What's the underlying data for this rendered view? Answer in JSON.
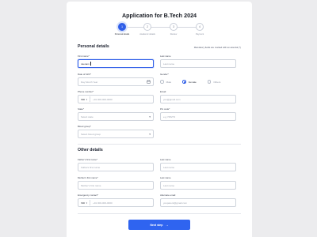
{
  "title": "Application for B.Tech 2024",
  "stepper": [
    {
      "num": "1",
      "label": "Personal details",
      "active": true
    },
    {
      "num": "2",
      "label": "Academic details",
      "active": false
    },
    {
      "num": "3",
      "label": "Review",
      "active": false
    },
    {
      "num": "4",
      "label": "Payment",
      "active": false
    }
  ],
  "personal": {
    "heading": "Personal details",
    "note": "Mandatory fields are marked with an asterisk (*)",
    "first_name": {
      "label": "First name*",
      "value": "Jeenam"
    },
    "last_name": {
      "label": "Last name",
      "placeholder": "Last name"
    },
    "dob": {
      "label": "Date of birth*",
      "placeholder": "Day Month Year",
      "icon": "calendar-icon"
    },
    "gender": {
      "label": "Gender*",
      "options": [
        "Male",
        "Female",
        "Others"
      ],
      "selected": "Female"
    },
    "phone": {
      "label": "Phone number*",
      "prefix": "IND",
      "placeholder": "+91 000-000-0000"
    },
    "email": {
      "label": "Email",
      "placeholder": "you@gmail.com"
    },
    "state": {
      "label": "State*",
      "placeholder": "Select state",
      "icon": "chevron-down-icon"
    },
    "pincode": {
      "label": "Pin code*",
      "placeholder": "e.g 725273"
    },
    "blood_group": {
      "label": "Blood group*",
      "placeholder": "Select blood group",
      "icon": "chevron-down-icon"
    }
  },
  "other": {
    "heading": "Other details",
    "father_first": {
      "label": "Father's first name*",
      "placeholder": "Fathers first name"
    },
    "father_last": {
      "label": "Last name",
      "placeholder": "Last name"
    },
    "mother_first": {
      "label": "Mother's first name*",
      "placeholder": "Mother's first name"
    },
    "mother_last": {
      "label": "Last name",
      "placeholder": "Last name"
    },
    "emergency": {
      "label": "Emergency contact*",
      "prefix": "IND",
      "placeholder": "+91 000-000-0000"
    },
    "alt_email": {
      "label": "Alternate email",
      "placeholder": "youparent@gmail.com"
    }
  },
  "next_button": {
    "label": "Next step",
    "icon": "arrow-right-icon"
  },
  "colors": {
    "accent": "#2f64f0",
    "background": "#ececee",
    "card": "#ffffff"
  }
}
